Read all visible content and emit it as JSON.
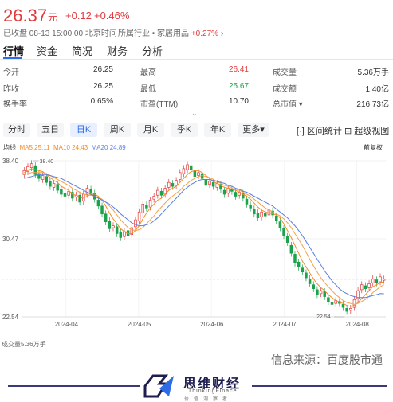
{
  "quote": {
    "price": "26.37",
    "unit": "元",
    "change": "+0.12",
    "change_pct": "+0.46%",
    "close_info": "已收盘 08-13 15:00:00 北京时间",
    "industry_label": "所属行业 • 家居用品",
    "industry_pct": "+0.27%",
    "industry_chevron": "›"
  },
  "tabs": [
    "行情",
    "资金",
    "简况",
    "财务",
    "分析"
  ],
  "stats": [
    [
      {
        "label": "今开",
        "value": "26.25",
        "color": "normal"
      },
      {
        "label": "最高",
        "value": "26.41",
        "color": "red"
      },
      {
        "label": "成交量",
        "value": "5.36万手",
        "color": "normal"
      }
    ],
    [
      {
        "label": "昨收",
        "value": "26.25",
        "color": "normal"
      },
      {
        "label": "最低",
        "value": "25.67",
        "color": "green"
      },
      {
        "label": "成交额",
        "value": "1.40亿",
        "color": "normal"
      }
    ],
    [
      {
        "label": "换手率",
        "value": "0.65%",
        "color": "normal"
      },
      {
        "label": "市盈(TTM)",
        "value": "10.70",
        "color": "normal"
      },
      {
        "label": "总市值 ▾",
        "value": "216.73亿",
        "color": "normal"
      }
    ]
  ],
  "expand_chevron": "⌄",
  "periods": [
    "分时",
    "五日",
    "日K",
    "周K",
    "月K",
    "季K",
    "年K",
    "更多▾"
  ],
  "active_period": "日K",
  "tools": {
    "interval": "区间统计",
    "super": "超级视图"
  },
  "ma_legend": {
    "title": "均线",
    "ma5": "MA5 25.11",
    "ma10": "MA10 24.43",
    "ma20": "MA20 24.89",
    "restore": "前复权"
  },
  "colors": {
    "up": "#e4393c",
    "down": "#1aa34a",
    "ma5": "#f28c28",
    "ma10": "#f28c28",
    "ma20": "#5b7fe0",
    "accent": "#2e6be6"
  },
  "chart_data": {
    "type": "candlestick",
    "y_ticks": [
      "38.40",
      "30.47",
      "22.54"
    ],
    "x_ticks": [
      "2024-04",
      "2024-05",
      "2024-06",
      "2024-07",
      "2024-08"
    ],
    "annotations": {
      "high": "38.40",
      "low": "22.54"
    },
    "ylim": [
      22.54,
      38.4
    ],
    "last_close": 26.37,
    "closes": [
      37.4,
      37.8,
      38.1,
      37.0,
      36.6,
      36.9,
      36.2,
      35.8,
      36.1,
      35.4,
      35.0,
      34.8,
      35.3,
      34.6,
      34.9,
      34.2,
      35.0,
      35.6,
      35.2,
      34.5,
      33.8,
      33.0,
      32.2,
      31.5,
      31.8,
      31.0,
      30.6,
      31.2,
      30.8,
      31.6,
      32.4,
      33.2,
      34.0,
      33.6,
      34.4,
      34.8,
      35.4,
      34.9,
      35.6,
      36.2,
      35.8,
      36.4,
      37.2,
      37.6,
      38.0,
      37.5,
      36.8,
      37.2,
      36.6,
      35.9,
      36.3,
      35.8,
      36.1,
      35.5,
      35.0,
      35.6,
      35.3,
      34.8,
      35.2,
      34.6,
      34.0,
      33.6,
      33.0,
      32.6,
      33.2,
      32.8,
      33.4,
      32.9,
      32.3,
      31.6,
      30.8,
      30.1,
      29.0,
      28.0,
      27.6,
      27.1,
      26.5,
      25.9,
      25.4,
      24.8,
      25.2,
      24.6,
      24.1,
      23.8,
      24.2,
      23.9,
      23.5,
      23.1,
      23.4,
      24.3,
      25.2,
      25.8,
      25.4,
      25.9,
      26.4,
      26.0,
      26.6,
      26.37
    ],
    "opens": [
      37.0,
      37.3,
      37.7,
      37.9,
      37.1,
      36.5,
      36.8,
      36.3,
      35.7,
      36.0,
      35.5,
      35.1,
      34.9,
      35.2,
      34.7,
      34.9,
      34.3,
      35.0,
      35.5,
      35.1,
      34.4,
      33.8,
      33.0,
      32.3,
      31.6,
      31.7,
      31.1,
      30.7,
      31.3,
      30.9,
      31.7,
      32.3,
      33.1,
      33.9,
      33.7,
      34.5,
      34.9,
      35.3,
      35.0,
      35.7,
      36.1,
      35.9,
      36.5,
      37.1,
      37.5,
      37.9,
      37.4,
      36.9,
      37.1,
      36.5,
      36.0,
      36.2,
      35.7,
      36.0,
      35.4,
      35.1,
      35.5,
      35.2,
      34.9,
      35.1,
      34.5,
      33.9,
      33.5,
      33.1,
      32.7,
      33.1,
      32.9,
      33.3,
      32.8,
      32.2,
      31.5,
      30.7,
      29.8,
      28.9,
      28.1,
      27.5,
      27.0,
      26.4,
      25.8,
      25.3,
      24.9,
      25.1,
      24.5,
      24.0,
      23.9,
      24.1,
      23.8,
      23.4,
      23.2,
      23.5,
      24.4,
      25.3,
      25.7,
      25.5,
      26.0,
      26.3,
      26.1,
      26.25
    ],
    "ma5": [
      37.2,
      37.4,
      37.6,
      37.5,
      37.4,
      37.3,
      37.0,
      36.7,
      36.4,
      36.2,
      35.8,
      35.6,
      35.4,
      35.0,
      34.9,
      34.7,
      34.6,
      34.8,
      35.0,
      35.0,
      34.8,
      34.4,
      33.8,
      33.1,
      32.5,
      32.0,
      31.5,
      31.2,
      31.0,
      31.0,
      31.3,
      31.8,
      32.5,
      33.1,
      33.6,
      34.0,
      34.4,
      34.6,
      35.0,
      35.4,
      35.6,
      35.8,
      36.2,
      36.6,
      37.0,
      37.3,
      37.4,
      37.4,
      37.2,
      36.9,
      36.6,
      36.3,
      36.1,
      35.9,
      35.7,
      35.6,
      35.5,
      35.4,
      35.2,
      35.0,
      34.8,
      34.5,
      34.1,
      33.7,
      33.4,
      33.2,
      33.1,
      33.0,
      32.9,
      32.6,
      32.0,
      31.3,
      30.6,
      29.8,
      29.0,
      28.2,
      27.6,
      27.0,
      26.4,
      25.9,
      25.5,
      25.2,
      24.8,
      24.5,
      24.2,
      24.0,
      23.9,
      23.7,
      23.6,
      23.7,
      24.0,
      24.4,
      24.8,
      25.2,
      25.6,
      25.8,
      26.0,
      26.1
    ],
    "ma10": [
      37.0,
      37.1,
      37.2,
      37.2,
      37.2,
      37.2,
      37.1,
      36.9,
      36.7,
      36.5,
      36.3,
      36.1,
      35.9,
      35.6,
      35.4,
      35.2,
      35.0,
      34.9,
      34.9,
      34.8,
      34.7,
      34.5,
      34.2,
      33.8,
      33.4,
      32.9,
      32.4,
      32.0,
      31.6,
      31.4,
      31.3,
      31.4,
      31.6,
      32.0,
      32.4,
      32.8,
      33.3,
      33.7,
      34.1,
      34.5,
      34.8,
      35.1,
      35.4,
      35.8,
      36.1,
      36.4,
      36.6,
      36.8,
      36.9,
      36.8,
      36.7,
      36.5,
      36.3,
      36.1,
      35.9,
      35.8,
      35.6,
      35.5,
      35.4,
      35.2,
      35.0,
      34.8,
      34.5,
      34.2,
      33.9,
      33.6,
      33.4,
      33.2,
      33.0,
      32.8,
      32.5,
      32.1,
      31.6,
      31.0,
      30.4,
      29.8,
      29.1,
      28.4,
      27.7,
      27.1,
      26.5,
      26.0,
      25.6,
      25.2,
      24.8,
      24.5,
      24.2,
      24.0,
      23.9,
      23.8,
      23.9,
      24.1,
      24.3,
      24.6,
      25.0,
      25.3,
      25.6,
      25.8
    ],
    "ma20": [
      36.6,
      36.7,
      36.8,
      36.9,
      37.0,
      37.0,
      37.0,
      36.9,
      36.8,
      36.7,
      36.6,
      36.4,
      36.2,
      36.0,
      35.8,
      35.6,
      35.4,
      35.2,
      35.0,
      34.8,
      34.6,
      34.4,
      34.2,
      34.0,
      33.7,
      33.4,
      33.0,
      32.7,
      32.4,
      32.1,
      31.9,
      31.8,
      31.8,
      31.9,
      32.0,
      32.3,
      32.6,
      33.0,
      33.4,
      33.8,
      34.2,
      34.6,
      35.0,
      35.4,
      35.7,
      36.0,
      36.2,
      36.4,
      36.5,
      36.5,
      36.5,
      36.4,
      36.3,
      36.2,
      36.1,
      35.9,
      35.8,
      35.6,
      35.5,
      35.3,
      35.2,
      35.0,
      34.8,
      34.6,
      34.4,
      34.2,
      34.0,
      33.8,
      33.5,
      33.2,
      32.9,
      32.6,
      32.2,
      31.8,
      31.3,
      30.8,
      30.2,
      29.6,
      29.0,
      28.4,
      27.8,
      27.2,
      26.7,
      26.2,
      25.8,
      25.4,
      25.1,
      24.9,
      24.7,
      24.6,
      24.5,
      24.5,
      24.5,
      24.6,
      24.7,
      24.8,
      24.9,
      24.89
    ]
  },
  "volume_label": "成交量5.36万手",
  "footer": {
    "source": "信息来源：百度股市通",
    "brand": "思维财经",
    "brand_en": "ThinkingFinace",
    "brand_sub": "价值洞察者"
  }
}
